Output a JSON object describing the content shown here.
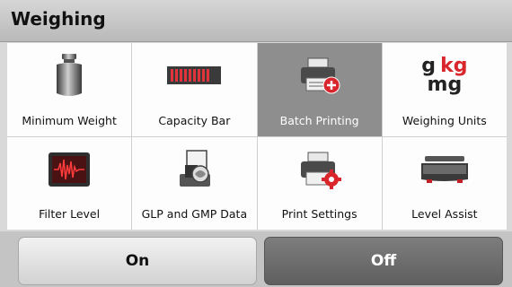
{
  "header": {
    "title": "Weighing"
  },
  "tiles": [
    {
      "label": "Minimum Weight",
      "icon": "weight-icon",
      "selected": false
    },
    {
      "label": "Capacity Bar",
      "icon": "capacity-bar-icon",
      "selected": false
    },
    {
      "label": "Batch Printing",
      "icon": "batch-printing-icon",
      "selected": true
    },
    {
      "label": "Weighing Units",
      "icon": "units-icon",
      "selected": false
    },
    {
      "label": "Filter Level",
      "icon": "filter-level-icon",
      "selected": false
    },
    {
      "label": "GLP and GMP Data",
      "icon": "glp-gmp-icon",
      "selected": false
    },
    {
      "label": "Print Settings",
      "icon": "print-settings-icon",
      "selected": false
    },
    {
      "label": "Level Assist",
      "icon": "level-assist-icon",
      "selected": false
    }
  ],
  "units_icon_text": {
    "g": "g",
    "kg": "kg",
    "mg": "mg"
  },
  "buttons": {
    "on": "On",
    "off": "Off",
    "active": "off"
  },
  "colors": {
    "accent_red": "#d9262c",
    "selected_tile": "#8e8e8e"
  }
}
